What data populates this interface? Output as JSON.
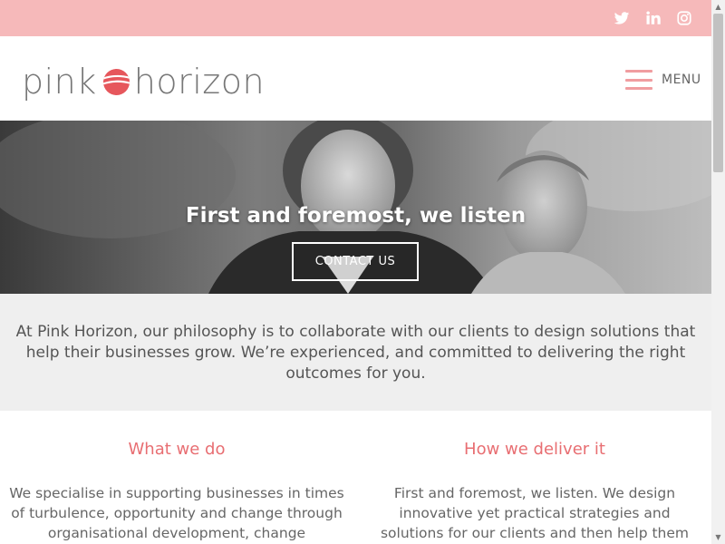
{
  "topbar": {
    "background": "#f6b9ba",
    "icons": [
      {
        "name": "twitter-icon"
      },
      {
        "name": "linkedin-icon"
      },
      {
        "name": "instagram-icon"
      }
    ]
  },
  "header": {
    "logo_left": "pink",
    "logo_right": "horizon",
    "menu_label": "MENU",
    "accent": "#f09da0"
  },
  "hero": {
    "title": "First and foremost, we listen",
    "button_label": "CONTACT US"
  },
  "intro": {
    "text": "At Pink Horizon, our philosophy is to collaborate with our clients to design solutions that help their businesses grow. We’re experienced, and committed to delivering the right outcomes for you."
  },
  "columns": [
    {
      "title": "What we do",
      "text": "We specialise in supporting businesses in times of turbulence, opportunity and change through organisational development, change management"
    },
    {
      "title": "How we deliver it",
      "text": "First and foremost, we listen. We design innovative yet practical strategies and solutions for our clients and then help them implement them successfully."
    }
  ],
  "colors": {
    "heading_pink": "#e86e72",
    "intro_bg": "#efefef"
  }
}
